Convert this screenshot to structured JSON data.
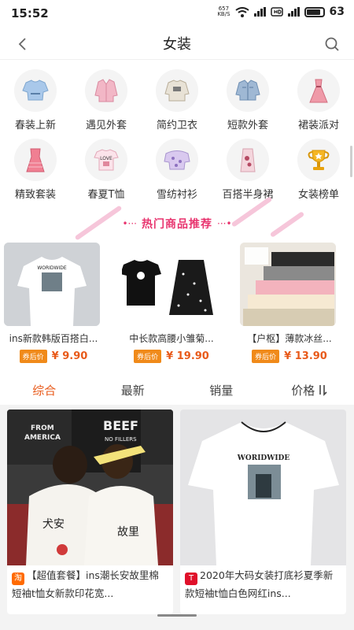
{
  "status_bar": {
    "time": "15:52",
    "net_speed_value": "657",
    "net_speed_unit": "KB/S",
    "battery": "63"
  },
  "nav": {
    "title": "女装"
  },
  "categories": [
    {
      "label": "春装上新",
      "icon": "blouse-icon"
    },
    {
      "label": "遇见外套",
      "icon": "coat-icon"
    },
    {
      "label": "简约卫衣",
      "icon": "hoodie-icon"
    },
    {
      "label": "短款外套",
      "icon": "denim-jacket-icon"
    },
    {
      "label": "裙装派对",
      "icon": "dress-icon"
    },
    {
      "label": "精致套装",
      "icon": "pink-dress-icon"
    },
    {
      "label": "春夏T恤",
      "icon": "tshirt-icon"
    },
    {
      "label": "雪纺衬衫",
      "icon": "chiffon-shirt-icon"
    },
    {
      "label": "百搭半身裙",
      "icon": "skirt-icon"
    },
    {
      "label": "女装榜单",
      "icon": "trophy-icon"
    }
  ],
  "hot_section": {
    "title": "热门商品推荐"
  },
  "recommended": [
    {
      "name": "ins新款韩版百搭白...",
      "coupon": "券后价",
      "price": "¥ 9.90",
      "img_text": "WORIDWIDE"
    },
    {
      "name": "中长款高腰小雏菊...",
      "coupon": "券后价",
      "price": "¥ 19.90"
    },
    {
      "name": "【户枢】薄款冰丝...",
      "coupon": "券后价",
      "price": "¥ 13.90"
    }
  ],
  "sort_tabs": [
    {
      "label": "综合",
      "active": true
    },
    {
      "label": "最新",
      "active": false
    },
    {
      "label": "销量",
      "active": false
    },
    {
      "label": "价格",
      "active": false
    }
  ],
  "products": [
    {
      "shop_tag": "淘",
      "title": "【超值套餐】ins潮长安故里棉短袖t恤女新款印花宽...",
      "img_texts": [
        "FROM",
        "AMERICA",
        "BEEF",
        "NO FILLERS",
        "犬安",
        "故里"
      ]
    },
    {
      "shop_tag": "T",
      "title": "2020年大码女装打底衫夏季新款短袖t恤白色网红ins...",
      "img_texts": [
        "WORIDWIDE"
      ]
    }
  ],
  "colors": {
    "accent": "#e85a1a",
    "hot": "#e8356f",
    "coupon": "#f08a1a",
    "taobao": "#ff6a00",
    "tmall": "#e0102a"
  }
}
